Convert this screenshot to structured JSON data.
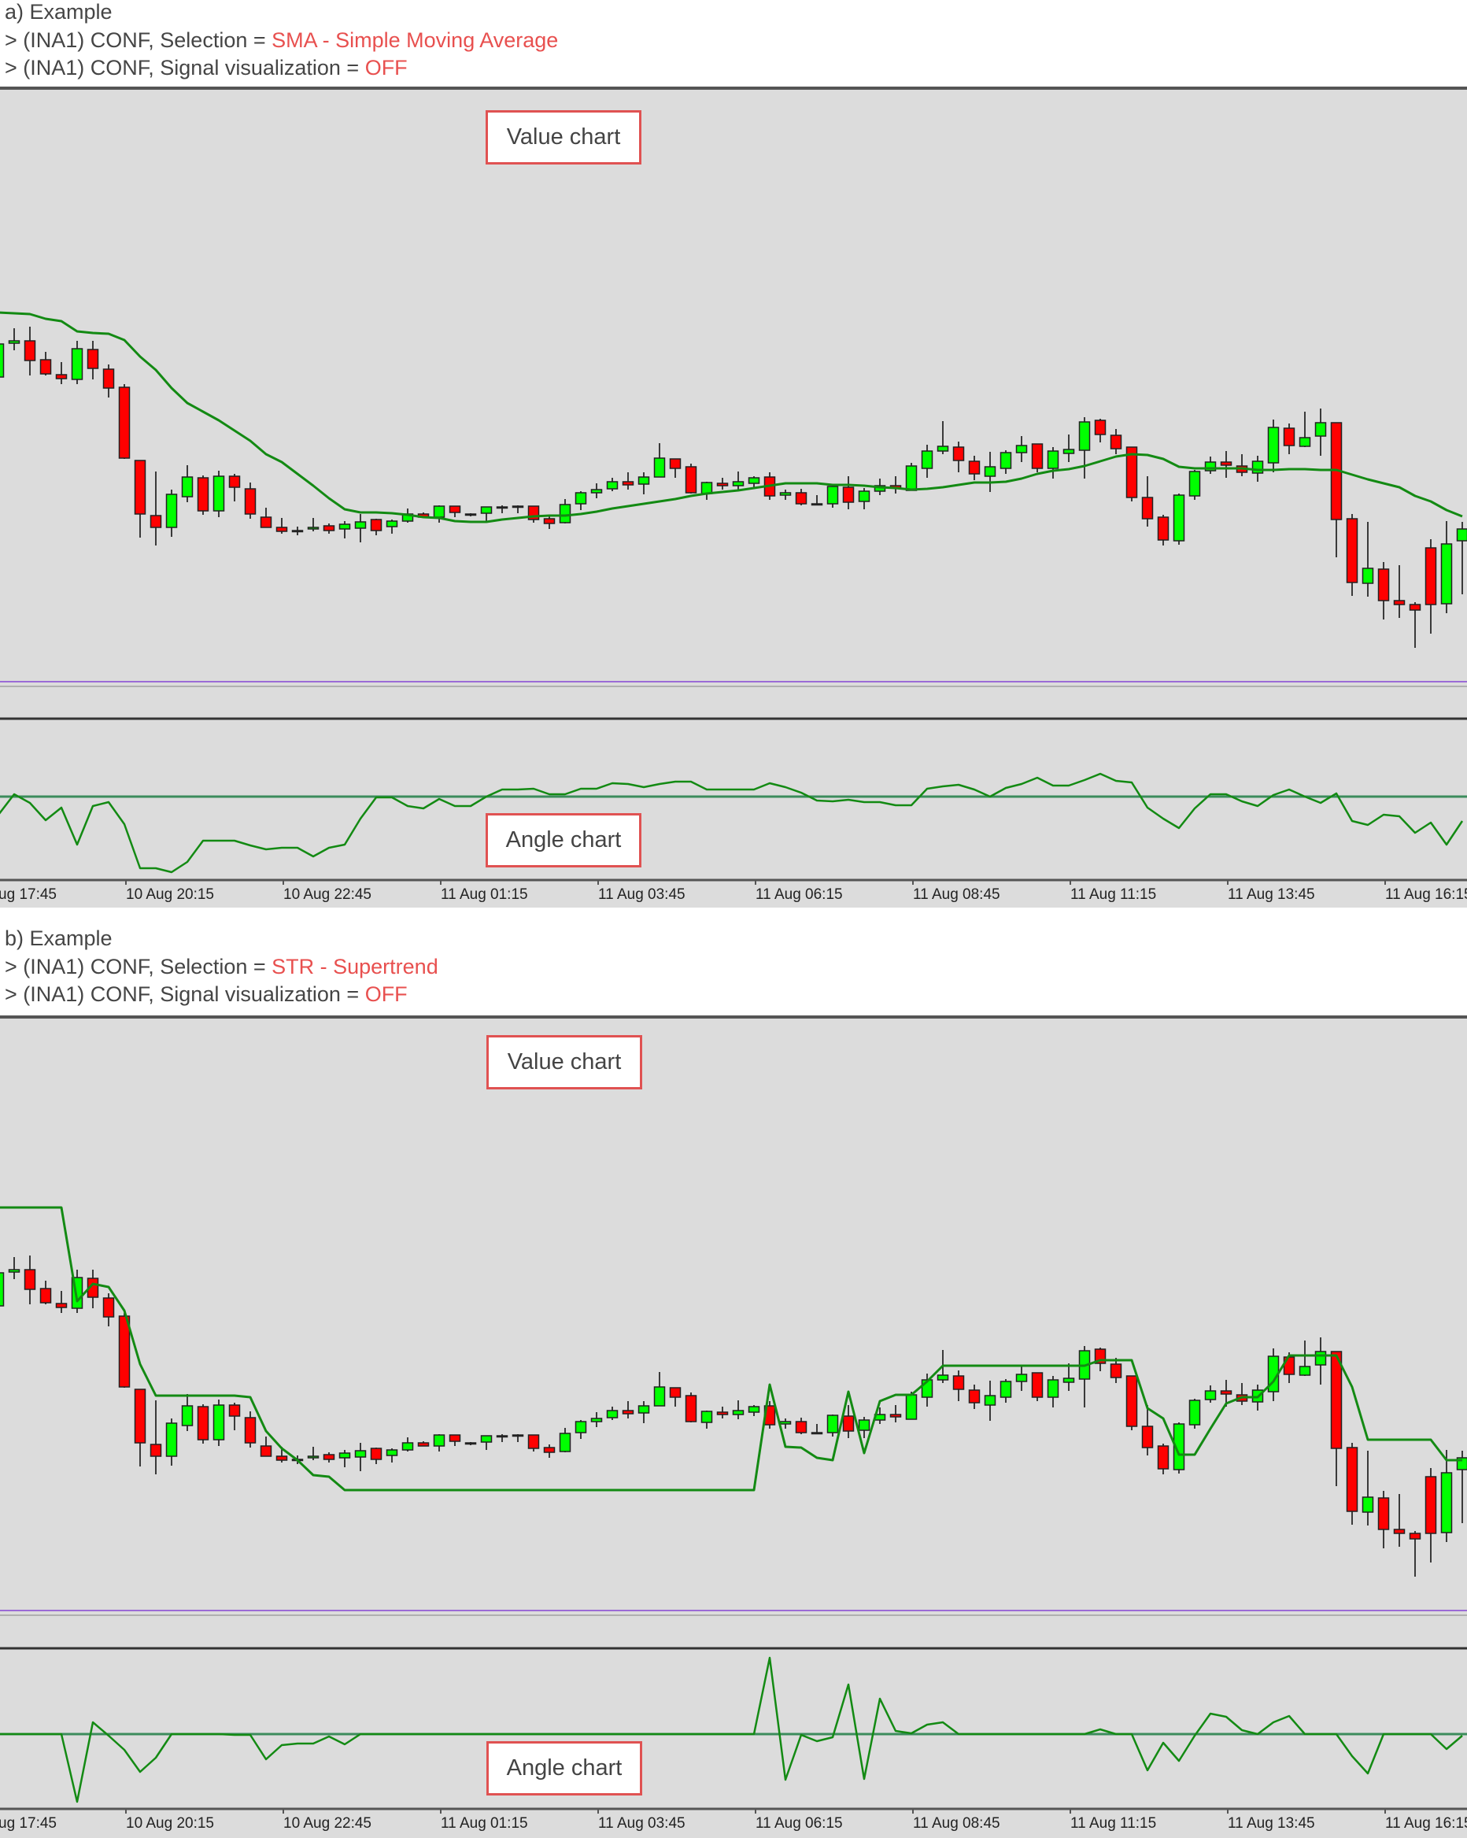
{
  "examples": [
    {
      "title": "a) Example",
      "lines": [
        {
          "prefix": "> (INA1) CONF, Selection = ",
          "value": "SMA - Simple Moving Average"
        },
        {
          "prefix": "> (INA1) CONF, Signal visualization = ",
          "value": "OFF"
        }
      ],
      "value_chart_label": "Value chart",
      "angle_chart_label": "Angle chart"
    },
    {
      "title": "b) Example",
      "lines": [
        {
          "prefix": "> (INA1) CONF, Selection = ",
          "value": "STR - Supertrend"
        },
        {
          "prefix": "> (INA1) CONF, Signal visualization = ",
          "value": "OFF"
        }
      ],
      "value_chart_label": "Value chart",
      "angle_chart_label": "Angle chart"
    }
  ],
  "colors": {
    "chart_background": "#dcdcdc",
    "bull_candle": "#00ff00",
    "bear_candle": "#ff0000",
    "indicator_line": "#138a13",
    "angle_zero_line": "#3c8c5c",
    "level_line": "#9b6bd6",
    "highlight_text": "#e8504f",
    "label_box_border": "#e05252"
  },
  "chart_data": {
    "type": "candlestick",
    "x_tick_labels": [
      "10 Aug 17:45",
      "10 Aug 20:15",
      "10 Aug 22:45",
      "11 Aug 01:15",
      "11 Aug 03:45",
      "11 Aug 06:15",
      "11 Aug 08:45",
      "11 Aug 11:15",
      "11 Aug 13:45",
      "11 Aug 16:15"
    ],
    "ohlc": [
      [
        421,
        463,
        421,
        463
      ],
      [
        464,
        483,
        455,
        467
      ],
      [
        467,
        485,
        423,
        442
      ],
      [
        443,
        453,
        423,
        425
      ],
      [
        424,
        440,
        412,
        419
      ],
      [
        418,
        467,
        412,
        457
      ],
      [
        456,
        467,
        418,
        432
      ],
      [
        431,
        437,
        395,
        407
      ],
      [
        408,
        412,
        317,
        318
      ],
      [
        315,
        315,
        217,
        247
      ],
      [
        245,
        301,
        207,
        230
      ],
      [
        230,
        278,
        218,
        272
      ],
      [
        269,
        309,
        262,
        294
      ],
      [
        293,
        296,
        246,
        251
      ],
      [
        251,
        302,
        243,
        295
      ],
      [
        295,
        298,
        263,
        281
      ],
      [
        279,
        287,
        241,
        247
      ],
      [
        243,
        255,
        230,
        230
      ],
      [
        230,
        242,
        222,
        225
      ],
      [
        226,
        231,
        220,
        226
      ],
      [
        228,
        242,
        225,
        230
      ],
      [
        232,
        235,
        222,
        226
      ],
      [
        228,
        238,
        216,
        234
      ],
      [
        229,
        247,
        211,
        237
      ],
      [
        240,
        241,
        220,
        226
      ],
      [
        231,
        240,
        222,
        238
      ],
      [
        238,
        254,
        236,
        247
      ],
      [
        247,
        249,
        243,
        243
      ],
      [
        243,
        258,
        236,
        257
      ],
      [
        257,
        257,
        243,
        249
      ],
      [
        247,
        248,
        244,
        247
      ],
      [
        248,
        256,
        238,
        256
      ],
      [
        256,
        258,
        248,
        256
      ],
      [
        257,
        258,
        248,
        257
      ],
      [
        257,
        257,
        236,
        240
      ],
      [
        241,
        245,
        228,
        235
      ],
      [
        236,
        266,
        235,
        259
      ],
      [
        260,
        276,
        252,
        274
      ],
      [
        274,
        286,
        267,
        278
      ],
      [
        279,
        293,
        276,
        288
      ],
      [
        288,
        300,
        278,
        284
      ],
      [
        285,
        300,
        272,
        294
      ],
      [
        294,
        337,
        294,
        318
      ],
      [
        317,
        317,
        293,
        305
      ],
      [
        307,
        311,
        273,
        274
      ],
      [
        273,
        288,
        265,
        287
      ],
      [
        286,
        293,
        278,
        283
      ],
      [
        283,
        301,
        277,
        288
      ],
      [
        286,
        295,
        281,
        293
      ],
      [
        294,
        300,
        265,
        270
      ],
      [
        271,
        278,
        265,
        274
      ],
      [
        274,
        279,
        258,
        260
      ],
      [
        260,
        271,
        258,
        260
      ],
      [
        260,
        283,
        255,
        282
      ],
      [
        281,
        295,
        253,
        262
      ],
      [
        263,
        280,
        253,
        276
      ],
      [
        276,
        292,
        271,
        283
      ],
      [
        283,
        295,
        273,
        280
      ],
      [
        277,
        312,
        277,
        308
      ],
      [
        305,
        335,
        293,
        327
      ],
      [
        327,
        365,
        323,
        333
      ],
      [
        332,
        339,
        300,
        315
      ],
      [
        314,
        321,
        290,
        298
      ],
      [
        295,
        326,
        275,
        307
      ],
      [
        305,
        328,
        298,
        325
      ],
      [
        325,
        346,
        313,
        334
      ],
      [
        336,
        336,
        300,
        305
      ],
      [
        305,
        332,
        292,
        327
      ],
      [
        324,
        348,
        313,
        329
      ],
      [
        328,
        370,
        292,
        364
      ],
      [
        366,
        368,
        338,
        348
      ],
      [
        347,
        355,
        323,
        330
      ],
      [
        332,
        332,
        263,
        268
      ],
      [
        268,
        295,
        231,
        241
      ],
      [
        243,
        246,
        207,
        214
      ],
      [
        213,
        273,
        208,
        271
      ],
      [
        270,
        303,
        265,
        301
      ],
      [
        302,
        320,
        298,
        313
      ],
      [
        313,
        327,
        293,
        309
      ],
      [
        308,
        323,
        295,
        300
      ],
      [
        299,
        321,
        288,
        314
      ],
      [
        312,
        367,
        300,
        357
      ],
      [
        356,
        362,
        323,
        334
      ],
      [
        333,
        377,
        332,
        344
      ],
      [
        346,
        381,
        321,
        363
      ],
      [
        363,
        363,
        192,
        240
      ],
      [
        241,
        247,
        143,
        160
      ],
      [
        159,
        237,
        142,
        178
      ],
      [
        177,
        186,
        113,
        137
      ],
      [
        137,
        182,
        115,
        132
      ],
      [
        132,
        135,
        77,
        125
      ],
      [
        204,
        215,
        95,
        132
      ],
      [
        133,
        238,
        121,
        209
      ],
      [
        213,
        237,
        145,
        228
      ]
    ],
    "panels": [
      {
        "overlay": [
          503,
          502,
          501,
          495,
          492,
          479,
          477,
          476,
          468,
          447,
          430,
          407,
          388,
          377,
          366,
          353,
          340,
          323,
          313,
          298,
          283,
          267,
          253,
          249,
          249,
          248,
          246,
          243,
          242,
          238,
          237,
          237,
          240,
          242,
          244,
          245,
          245,
          247,
          250,
          254,
          257,
          260,
          263,
          266,
          270,
          273,
          275,
          277,
          280,
          283,
          286,
          286,
          286,
          284,
          284,
          283,
          281,
          280,
          278,
          279,
          281,
          284,
          287,
          287,
          288,
          292,
          298,
          302,
          304,
          308,
          314,
          320,
          323,
          322,
          317,
          307,
          305,
          305,
          305,
          305,
          303,
          303,
          304,
          304,
          303,
          303,
          297,
          291,
          286,
          281,
          270,
          263,
          252,
          244
        ],
        "angle": [
          -23,
          3,
          -8,
          -30,
          -14,
          -61,
          -12,
          -7,
          -35,
          -91,
          -91,
          -96,
          -83,
          -56,
          -56,
          -56,
          -62,
          -67,
          -65,
          -65,
          -76,
          -65,
          -61,
          -28,
          -1,
          -1,
          -12,
          -15,
          -3,
          -12,
          -12,
          0,
          9,
          9,
          10,
          3,
          3,
          10,
          10,
          17,
          16,
          12,
          16,
          19,
          19,
          9,
          9,
          9,
          9,
          17,
          12,
          5,
          -5,
          -6,
          -4,
          -7,
          -7,
          -11,
          -11,
          10,
          13,
          15,
          9,
          0,
          11,
          16,
          24,
          14,
          14,
          21,
          29,
          20,
          18,
          -14,
          -28,
          -40,
          -15,
          3,
          3,
          -6,
          -12,
          2,
          9,
          0,
          -8,
          4,
          -31,
          -36,
          -23,
          -25,
          -46,
          -33,
          -61,
          -31
        ]
      },
      {
        "overlay": [
          546,
          546,
          546,
          546,
          546,
          427,
          449,
          445,
          415,
          347,
          307,
          307,
          307,
          307,
          307,
          307,
          305,
          262,
          240,
          225,
          206,
          204,
          187,
          187,
          187,
          187,
          187,
          187,
          187,
          187,
          187,
          187,
          187,
          187,
          187,
          187,
          187,
          187,
          187,
          187,
          187,
          187,
          187,
          187,
          187,
          187,
          187,
          187,
          187,
          321,
          242,
          241,
          228,
          225,
          312,
          234,
          300,
          308,
          308,
          325,
          345,
          345,
          345,
          345,
          345,
          345,
          345,
          345,
          345,
          345,
          352,
          352,
          352,
          291,
          278,
          232,
          232,
          265,
          297,
          305,
          305,
          325,
          358,
          358,
          358,
          358,
          318,
          251,
          251,
          251,
          251,
          251,
          225,
          225
        ],
        "angle": [
          0,
          0,
          0,
          0,
          0,
          -86,
          15,
          -2,
          -20,
          -48,
          -30,
          0,
          0,
          0,
          0,
          -1,
          -1,
          -32,
          -14,
          -12,
          -12,
          -3,
          -13,
          0,
          0,
          0,
          0,
          0,
          0,
          0,
          0,
          0,
          0,
          0,
          0,
          0,
          0,
          0,
          0,
          0,
          0,
          0,
          0,
          0,
          0,
          0,
          0,
          0,
          0,
          97,
          -58,
          -1,
          -9,
          -4,
          63,
          -57,
          45,
          4,
          1,
          12,
          15,
          0,
          0,
          0,
          0,
          0,
          0,
          0,
          0,
          0,
          6,
          0,
          0,
          -46,
          -11,
          -34,
          -2,
          26,
          22,
          5,
          0,
          15,
          23,
          0,
          0,
          0,
          -28,
          -50,
          0,
          0,
          0,
          0,
          -19,
          -2
        ]
      }
    ]
  }
}
